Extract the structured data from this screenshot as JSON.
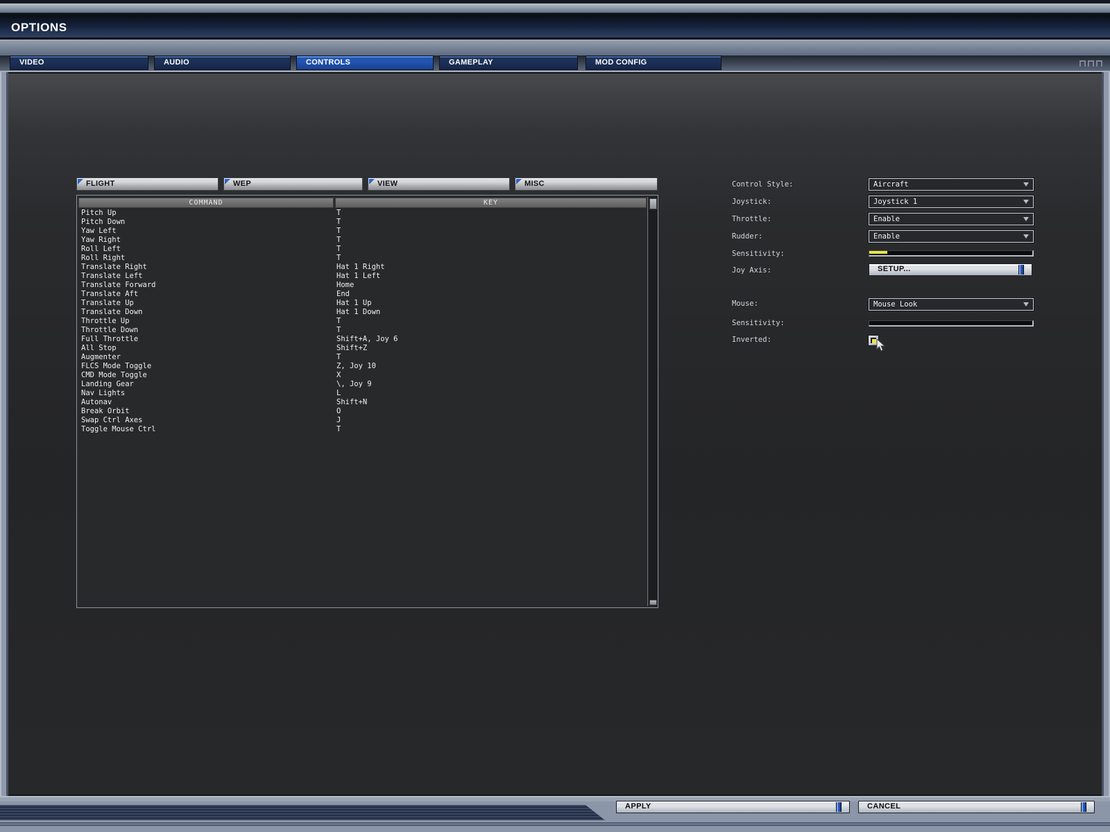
{
  "window": {
    "title": "OPTIONS"
  },
  "tabs": [
    {
      "label": "VIDEO",
      "selected": false
    },
    {
      "label": "AUDIO",
      "selected": false
    },
    {
      "label": "CONTROLS",
      "selected": true
    },
    {
      "label": "GAMEPLAY",
      "selected": false
    },
    {
      "label": "MOD CONFIG",
      "selected": false
    }
  ],
  "subtabs": [
    {
      "label": "FLIGHT"
    },
    {
      "label": "WEP"
    },
    {
      "label": "VIEW"
    },
    {
      "label": "MISC"
    }
  ],
  "bindings_table": {
    "columns": [
      "COMMAND",
      "KEY"
    ],
    "rows": [
      [
        "Pitch Up",
        "T"
      ],
      [
        "Pitch Down",
        "T"
      ],
      [
        "Yaw Left",
        "T"
      ],
      [
        "Yaw Right",
        "T"
      ],
      [
        "Roll Left",
        "T"
      ],
      [
        "Roll Right",
        "T"
      ],
      [
        "Translate Right",
        "Hat 1 Right"
      ],
      [
        "Translate Left",
        "Hat 1 Left"
      ],
      [
        "Translate Forward",
        "Home"
      ],
      [
        "Translate Aft",
        "End"
      ],
      [
        "Translate Up",
        "Hat 1 Up"
      ],
      [
        "Translate Down",
        "Hat 1 Down"
      ],
      [
        "Throttle Up",
        "T"
      ],
      [
        "Throttle Down",
        "T"
      ],
      [
        "Full Throttle",
        "Shift+A, Joy 6"
      ],
      [
        "All Stop",
        "Shift+Z"
      ],
      [
        "Augmenter",
        "T"
      ],
      [
        "FLCS Mode Toggle",
        "Z, Joy 10"
      ],
      [
        "CMD Mode Toggle",
        "X"
      ],
      [
        "Landing Gear",
        "\\, Joy 9"
      ],
      [
        "Nav Lights",
        "L"
      ],
      [
        "Autonav",
        "Shift+N"
      ],
      [
        "Break Orbit",
        "O"
      ],
      [
        "Swap Ctrl Axes",
        "J"
      ],
      [
        "Toggle Mouse Ctrl",
        "T"
      ]
    ]
  },
  "settings": {
    "control_style": {
      "label": "Control Style:",
      "value": "Aircraft"
    },
    "joystick": {
      "label": "Joystick:",
      "value": "Joystick 1"
    },
    "throttle": {
      "label": "Throttle:",
      "value": "Enable"
    },
    "rudder": {
      "label": "Rudder:",
      "value": "Enable"
    },
    "joy_sensitivity": {
      "label": "Sensitivity:",
      "value_percent": 11
    },
    "joy_axis": {
      "label": "Joy Axis:",
      "button_label": "SETUP..."
    },
    "mouse": {
      "label": "Mouse:",
      "value": "Mouse Look"
    },
    "mouse_sensitivity": {
      "label": "Sensitivity:",
      "value_percent": 0
    },
    "inverted": {
      "label": "Inverted:",
      "checked": true
    }
  },
  "footer": {
    "apply_label": "APPLY",
    "cancel_label": "CANCEL"
  },
  "colors": {
    "frame": "#8e99ab",
    "tab_selected_blue": "#2255b2",
    "tab_blue": "#1d3158",
    "content_dark": "#26272a",
    "highlight_yellow": "#e9e546",
    "button_cap_blue": "#2a57c0"
  }
}
